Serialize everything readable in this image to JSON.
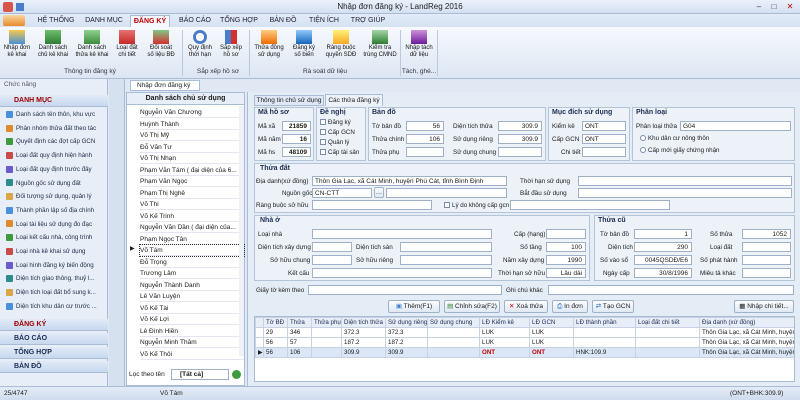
{
  "window": {
    "title": "Nhập đơn đăng ký - LandReg 2016"
  },
  "tabs": [
    "HỆ THỐNG",
    "DANH MỤC",
    "ĐĂNG KÝ",
    "BÁO CÁO",
    "TỔNG HỢP",
    "BẢN ĐỒ",
    "TIỆN ÍCH",
    "TRỢ GIÚP"
  ],
  "ribbon": {
    "groups": {
      "g1": "Thông tin đăng ký",
      "g2": "Sắp xếp hồ sơ",
      "g3": "Rà soát dữ liệu",
      "g4": "Tách, ghé..."
    },
    "buttons": [
      "Nhập đơn\nkê khai",
      "Danh sách\nchủ kê khai",
      "Danh sách\nthửa kê khai",
      "Loại đất\nchi tiết",
      "Đối soát\nsố liệu BĐ",
      "Quy định\nthời hạn",
      "Sắp xếp\nhồ sơ",
      "Thửa đồng\nsử dụng",
      "Đăng ký\nsố biến",
      "Ràng buộc\nquyền SDĐ",
      "Kiểm tra\ntrùng CMND",
      "Nhập tách\ndữ liệu"
    ]
  },
  "leftnav": {
    "header": "Chức năng",
    "section": "DANH MỤC",
    "items": [
      "Danh sách tên thôn, khu vực",
      "Phân nhóm thửa đất theo tác",
      "Quyết định các đợt cấp GCN",
      "Loại đất quy định hiện hành",
      "Loại đất quy định trước đây",
      "Nguồn gốc sử dụng đất",
      "Đối tượng sử dụng, quản lý",
      "Thành phần lập số địa chính",
      "Loại tài liệu sử dụng đo đạc",
      "Loại kết cấu nhà, công trình",
      "Loại nhà kê khai sử dụng",
      "Loại hình đăng ký biến động",
      "Diện tích giao thông, thuỷ l...",
      "Diện tích loại đất bổ sung k...",
      "Diện tích khu dân cư trước ..."
    ],
    "bottom": [
      "ĐĂNG KÝ",
      "BÁO CÁO",
      "TỔNG HỢP",
      "BẢN ĐỒ"
    ]
  },
  "doctab": "Nhập đơn đăng ký",
  "owners": {
    "header": "Danh sách chủ sử dụng",
    "items": [
      "Nguyễn Văn Chương",
      "Huỳnh Thành",
      "Võ Thị Mỹ",
      "Đỗ Văn Tư",
      "Võ Thị Nhạn",
      "Phạm Văn Tám ( đại diện của 6...",
      "Phạm Văn Ngọc",
      "Phạm Thị Nghê",
      "Võ Thi",
      "Võ Kế Trinh",
      "Nguyễn Văn Dần ( đại diện của...",
      "Phạm Ngọc Tân",
      "Võ Tám",
      "Đỗ Trọng",
      "Trương Lâm",
      "Nguyễn Thành Danh",
      "Lê Văn Luyện",
      "Võ Kế Tài",
      "Võ Kế Lợi",
      "Lê Đình Hiền",
      "Nguyễn Minh Thâm",
      "Võ Kế Thôi"
    ],
    "selected_index": 12,
    "filter_label": "Lọc theo tên",
    "filter_value": "[Tất cả]"
  },
  "form": {
    "tabs": [
      "Thông tin chủ sử dụng",
      "Các thửa đăng ký"
    ],
    "ho_so": {
      "title": "Mã hồ sơ",
      "ma_xa_label": "Mã xã",
      "ma_xa": "21859",
      "ma_nam_label": "Mã năm",
      "ma_nam": "16",
      "ma_hs_label": "Mã hs",
      "ma_hs": "48109"
    },
    "de_nghi": {
      "title": "Đề nghị",
      "opts": [
        "Đăng ký",
        "Cấp GCN",
        "Quản lý",
        "Cấp tài sản"
      ]
    },
    "ban_do": {
      "title": "Bản đồ",
      "to_label": "Tờ bản đồ",
      "to": "56",
      "thua_label": "Thửa chính",
      "thua": "106",
      "phu_label": "Thửa phụ",
      "phu": "",
      "dt_label": "Diện tích thửa",
      "dt": "309.9",
      "rieng_label": "Sử dụng riêng",
      "rieng": "309.9",
      "chung_label": "Sử dụng chung",
      "chung": ""
    },
    "muc_dich": {
      "title": "Mục đích sử dụng",
      "kk_label": "Kiểm kê",
      "kk": "ONT",
      "gcn_label": "Cấp GCN",
      "gcn": "ONT",
      "ct_label": "Chi tiết",
      "ct": ""
    },
    "phan_loai": {
      "title": "Phân loại",
      "lt_label": "Phân loại thửa",
      "lt": "G04",
      "opt1": "Khu dân cư nông thôn",
      "opt2": "Cấp mới giấy chứng nhận"
    },
    "thua_dat": {
      "title": "Thửa đất",
      "diadanh_label": "Địa danh(xứ đồng)",
      "diadanh": "Thôn Gia Lạc, xã Cát Minh, huyện Phù Cát, tỉnh Bình Định",
      "nguongoc_label": "Nguồn gốc",
      "nguongoc": "CN-CTT",
      "rangbuoc_label": "Ràng buộc sở hữu",
      "thoihan_label": "Thời hạn sử dụng",
      "batdau_label": "Bắt đầu sử dụng",
      "lydo_label": "Lý do không cấp gcn"
    },
    "nha_o": {
      "title": "Nhà ở",
      "loainha_label": "Loại nhà",
      "capnha_label": "Cấp (hạng)",
      "dtxd_label": "Diện tích xây dựng",
      "dtsan_label": "Diện tích sàn",
      "sotang_label": "Số tầng",
      "sotang": "100",
      "sochung_label": "Sở hữu chung",
      "sorieng_label": "Sở hữu riêng",
      "namxd_label": "Năm xây dựng",
      "namxd": "1990",
      "ketcau_label": "Kết cấu",
      "thsh_label": "Thời hạn sở hữu",
      "thsh": "Lâu dài"
    },
    "thua_cu": {
      "title": "Thửa cũ",
      "to_label": "Tờ bản đồ",
      "to": "1",
      "sothua_label": "Số thửa",
      "sothua": "1052",
      "dt_label": "Diện tích",
      "dt": "290",
      "loaidat_label": "Loại đất",
      "loaidat": "",
      "sovao_label": "Số vào sổ",
      "sovao": "0045QSDĐ/E6",
      "sophathanh_label": "Số phát hành",
      "sophathanh": "",
      "ngaycap_label": "Ngày cấp",
      "ngaycap": "30/8/1996",
      "mieutakhac_label": "Miêu tả khác",
      "mieutakhac": ""
    },
    "giayto_label": "Giấy tờ kèm theo",
    "ghichu_label": "Ghi chú khác",
    "buttons": {
      "them": "Thêm(F1)",
      "chinhsua": "Chỉnh sửa(F2)",
      "xoa": "Xoá thửa",
      "indon": "In đơn",
      "taogcn": "Tạo GCN",
      "nhapct": "Nhập chi tiết..."
    }
  },
  "grid": {
    "columns": [
      "Tờ BĐ",
      "Thửa",
      "Thửa phụ",
      "Diện tích thửa",
      "Sử dụng riêng",
      "Sử dụng chung",
      "LĐ Kiểm kê",
      "LĐ GCN",
      "LĐ thành phần",
      "Loại đất chi tiết",
      "Địa danh (xứ đồng)"
    ],
    "rows": [
      {
        "marker": "",
        "cells": [
          "29",
          "346",
          "",
          "372.3",
          "372.3",
          "",
          "LUK",
          "LUK",
          "",
          "",
          "Thôn Gia Lạc, xã Cát Minh, huyện"
        ]
      },
      {
        "marker": "",
        "cells": [
          "56",
          "57",
          "",
          "187.2",
          "187.2",
          "",
          "LUK",
          "LUK",
          "",
          "",
          "Thôn Gia Lạc, xã Cát Minh, huyện"
        ]
      },
      {
        "marker": "▶",
        "cells": [
          "56",
          "106",
          "",
          "309.9",
          "309.9",
          "",
          "ONT",
          "ONT",
          "HNK:109.9",
          "",
          "Thôn Gia Lạc, xã Cát Minh, huyện"
        ]
      }
    ]
  },
  "status": {
    "count": "25/4747",
    "current": "Võ Tám",
    "right": "(ONT+BHK:309.9)"
  },
  "colors": {
    "accent": "#c00000",
    "panel": "#e4ecf6",
    "border": "#a9bcd6"
  }
}
